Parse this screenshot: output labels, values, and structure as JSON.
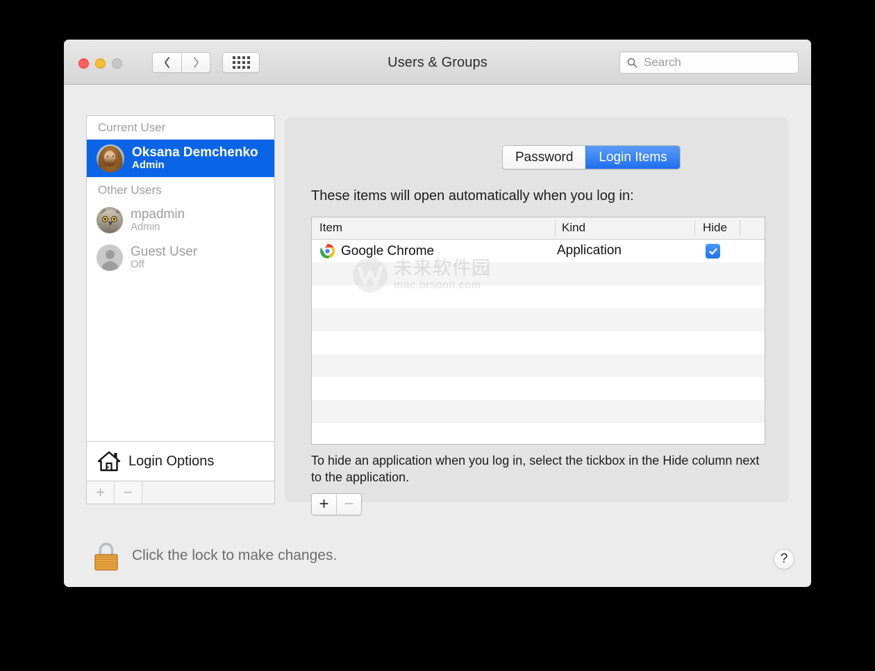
{
  "window": {
    "title": "Users & Groups",
    "traffic_lights": [
      "close",
      "minimize",
      "zoom"
    ],
    "nav": {
      "back": "‹",
      "forward": "›",
      "grid": "show-all"
    },
    "colors": {
      "accent_blue": "#0a64e6",
      "tab_blue": "#1f70ee",
      "checkbox_blue": "#1a76ef",
      "titlebar": "#dedede",
      "panel_bg": "#e3e3e3",
      "window_bg": "#ececec"
    }
  },
  "search": {
    "placeholder": "Search",
    "value": ""
  },
  "sidebar": {
    "groups": [
      {
        "header": "Current User",
        "users": [
          {
            "name": "Oksana Demchenko",
            "role": "Admin",
            "selected": true,
            "avatar": "photo-avatar"
          }
        ]
      },
      {
        "header": "Other Users",
        "users": [
          {
            "name": "mpadmin",
            "role": "Admin",
            "selected": false,
            "avatar": "owl-avatar"
          },
          {
            "name": "Guest User",
            "role": "Off",
            "selected": false,
            "avatar": "person-placeholder-avatar"
          }
        ]
      }
    ],
    "login_options": "Login Options",
    "footer_buttons": [
      {
        "label": "+",
        "name": "add-user-button",
        "enabled": false
      },
      {
        "label": "−",
        "name": "remove-user-button",
        "enabled": false
      }
    ]
  },
  "tabs": [
    {
      "label": "Password",
      "active": false
    },
    {
      "label": "Login Items",
      "active": true
    }
  ],
  "main": {
    "intro": "These items will open automatically when you log in:",
    "table": {
      "columns": [
        "Item",
        "Kind",
        "Hide"
      ],
      "rows": [
        {
          "item": "Google Chrome",
          "kind": "Application",
          "hide": true,
          "icon": "chrome-icon"
        }
      ],
      "empty_row_count": 9
    },
    "hint": "To hide an application when you log in, select the tickbox in the Hide column next to the application.",
    "buttons": [
      {
        "label": "+",
        "name": "add-login-item-button",
        "enabled": true
      },
      {
        "label": "−",
        "name": "remove-login-item-button",
        "enabled": false
      }
    ]
  },
  "footer": {
    "lock_text": "Click the lock to make changes.",
    "lock_state": "locked",
    "help_label": "?"
  },
  "watermark": {
    "chinese": "未来软件园",
    "url": "mac.orsoon.com"
  }
}
